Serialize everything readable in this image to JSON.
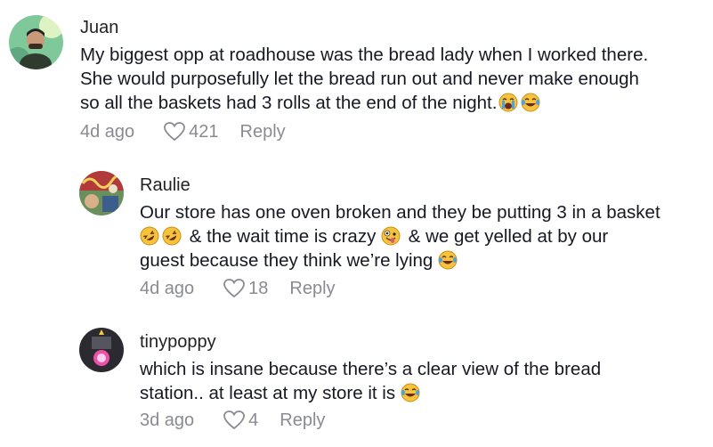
{
  "comments": [
    {
      "username": "Juan",
      "lines": [
        "My biggest opp at roadhouse was the bread lady when I worked there.",
        "She would purposefully let the bread run out and never make enough",
        "so all the baskets had 3 rolls at the end of the night."
      ],
      "emojis": [
        "loudly-crying-face",
        "face-with-tears-of-joy"
      ],
      "time": "4d ago",
      "likes": "421",
      "reply_label": "Reply"
    },
    {
      "username": "Raulie",
      "lines": [
        "Our store has one oven broken and they be putting 3 in a basket",
        "& the wait time is crazy",
        "& we get yelled at by our",
        "guest because they think we’re lying"
      ],
      "emojis": [
        "rolling-on-floor-laughing",
        "rolling-on-floor-laughing",
        "zany-face",
        "face-with-tears-of-joy"
      ],
      "time": "4d ago",
      "likes": "18",
      "reply_label": "Reply"
    },
    {
      "username": "tinypoppy",
      "lines": [
        "which is insane because there’s a clear view of the bread",
        "station.. at least at my store it is"
      ],
      "emojis": [
        "face-with-tears-of-joy"
      ],
      "time": "3d ago",
      "likes": "4",
      "reply_label": "Reply"
    }
  ],
  "icons": {
    "like": "heart-outline-icon"
  },
  "colors": {
    "text": "#161823",
    "meta": "#8a8b91",
    "emoji_yellow": "#f7c33c",
    "tear_blue": "#4aa3df"
  }
}
